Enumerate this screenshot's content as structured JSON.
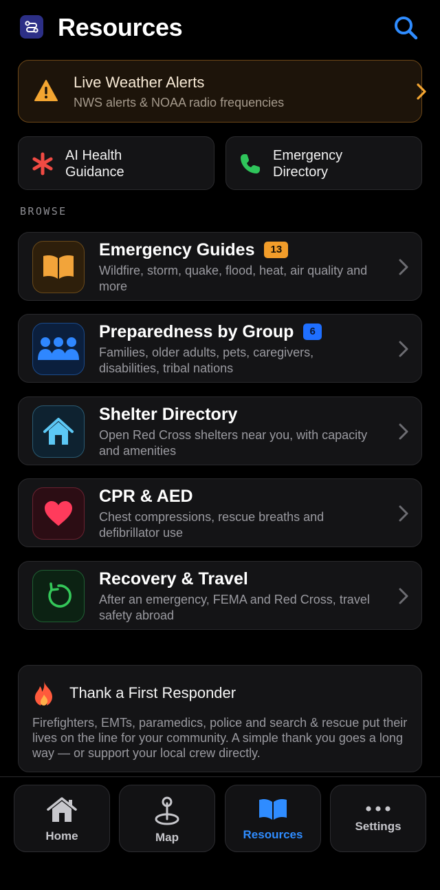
{
  "header": {
    "title": "Resources",
    "app_icon": "route-icon",
    "search_icon": "search-icon"
  },
  "alert_card": {
    "title": "Live Weather Alerts",
    "subtitle": "NWS alerts & NOAA radio frequencies",
    "icon": "warning-icon",
    "accent": "#f3a531"
  },
  "quick_actions": [
    {
      "label_line1": "AI Health",
      "label_line2": "Guidance",
      "icon": "asterisk-icon",
      "color": "#f04a43"
    },
    {
      "label_line1": "Emergency",
      "label_line2": "Directory",
      "icon": "phone-icon",
      "color": "#2fc55b"
    }
  ],
  "browse": {
    "label": "BROWSE",
    "items": [
      {
        "title": "Emergency Guides",
        "badge": "13",
        "badge_color": "#f29d2a",
        "description": "Wildfire, storm, quake, flood, heat, air quality and more",
        "icon": "book-icon",
        "color": "#f2a43a"
      },
      {
        "title": "Preparedness by Group",
        "badge": "6",
        "badge_color": "#1f6fff",
        "description": "Families, older adults, pets, caregivers, disabilities, tribal nations",
        "icon": "people-icon",
        "color": "#2f87ff"
      },
      {
        "title": "Shelter Directory",
        "badge": "",
        "description": "Open Red Cross shelters near you, with capacity and amenities",
        "icon": "house-icon",
        "color": "#5cc8f5"
      },
      {
        "title": "CPR & AED",
        "badge": "",
        "description": "Chest compressions, rescue breaths and defibrillator use",
        "icon": "heart-icon",
        "color": "#ff3b5c"
      },
      {
        "title": "Recovery & Travel",
        "badge": "",
        "description": "After an emergency, FEMA and Red Cross, travel safety abroad",
        "icon": "rotate-icon",
        "color": "#34c759"
      }
    ]
  },
  "thank_card": {
    "title": "Thank a First Responder",
    "body": "Firefighters, EMTs, paramedics, police and search & rescue put their lives on the line for your community. A simple thank you goes a long way — or support your local crew directly.",
    "icon": "flame-icon"
  },
  "tabs": [
    {
      "label": "Home",
      "icon": "house-icon",
      "selected": false
    },
    {
      "label": "Map",
      "icon": "map-pin-icon",
      "selected": false
    },
    {
      "label": "Resources",
      "icon": "book-icon",
      "selected": true
    },
    {
      "label": "Settings",
      "icon": "more-icon",
      "selected": false
    }
  ]
}
